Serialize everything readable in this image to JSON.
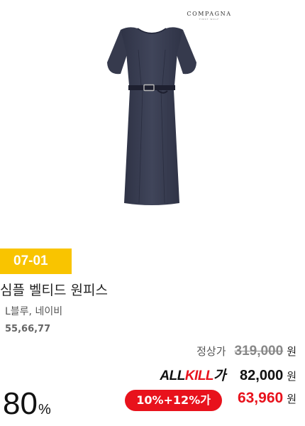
{
  "brand": {
    "name": "COMPAGNA",
    "sub": "FIRST WOLF"
  },
  "product": {
    "date_badge": "07-01",
    "title": "심플 벨티드 원피스",
    "colors": "L블루, 네이비",
    "sizes": "55,66,77",
    "image_icon": "navy-belted-dress-image"
  },
  "price": {
    "regular_label": "정상가",
    "regular_value": "319,000",
    "currency": "원",
    "allkill_logo_black": "ALL",
    "allkill_logo_red": "KILL",
    "allkill_logo_suffix": "가",
    "allkill_value": "82,000",
    "coupon_label": "10%+12%가",
    "final_value": "63,960",
    "discount_rate": "80",
    "discount_unit": "%"
  },
  "colors": {
    "badge": "#f9c400",
    "accent": "#e8121c",
    "dress": "#3b3f52"
  }
}
